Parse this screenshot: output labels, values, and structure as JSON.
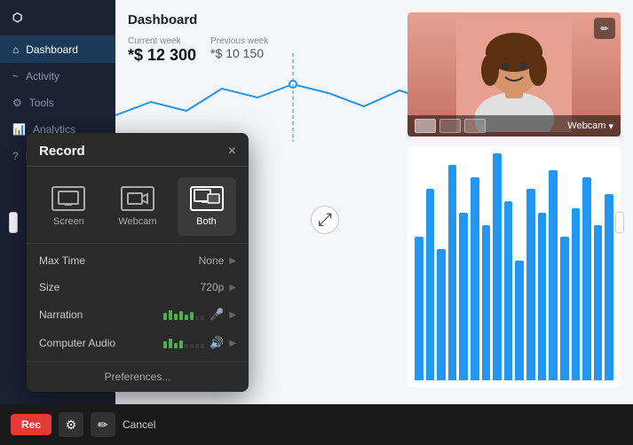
{
  "app": {
    "title": "Dashboard"
  },
  "sidebar": {
    "items": [
      {
        "label": "Dashboard",
        "active": true
      },
      {
        "label": "Activity",
        "active": false
      },
      {
        "label": "Tools",
        "active": false
      },
      {
        "label": "Analytics",
        "active": false
      },
      {
        "label": "Help",
        "active": false
      }
    ]
  },
  "stats": {
    "current_week_label": "Current week",
    "previous_week_label": "Previous week",
    "current_value": "*$ 12 300",
    "previous_value": "*$ 10 150"
  },
  "webcam": {
    "label": "Webcam",
    "edit_icon": "✏"
  },
  "record_dialog": {
    "title": "Record",
    "close": "×",
    "modes": [
      {
        "id": "screen",
        "label": "Screen",
        "active": false
      },
      {
        "id": "webcam",
        "label": "Webcam",
        "active": false
      },
      {
        "id": "both",
        "label": "Both",
        "active": true
      }
    ],
    "settings": [
      {
        "label": "Max Time",
        "value": "None",
        "has_arrow": true
      },
      {
        "label": "Size",
        "value": "720p",
        "has_arrow": true
      },
      {
        "label": "Narration",
        "value": "",
        "has_vol": true,
        "has_mic": true,
        "has_arrow": true
      },
      {
        "label": "Computer Audio",
        "value": "",
        "has_vol": true,
        "has_speaker": true,
        "has_arrow": true
      }
    ],
    "preferences_label": "Preferences..."
  },
  "toolbar": {
    "rec_label": "Rec",
    "cancel_label": "Cancel"
  },
  "bars": {
    "heights": [
      60,
      80,
      55,
      90,
      70,
      85,
      65,
      95,
      75,
      50,
      80,
      70,
      88,
      60,
      72,
      85,
      65,
      78
    ]
  }
}
